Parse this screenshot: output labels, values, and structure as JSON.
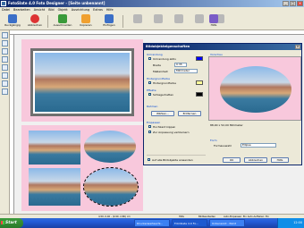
{
  "window": {
    "title": "FotoSlate 4.0 Foto Designer - [Seite unbenannt]"
  },
  "menu": [
    "Datei",
    "Bearbeiten",
    "Ansicht",
    "Bild",
    "Objekt",
    "Ausrichtung",
    "Extras",
    "Hilfe"
  ],
  "toolbar": {
    "rueckgaengig": "Ruckgängig",
    "abbrechen": "Abbrechen",
    "ausschneiden": "Ausschneiden",
    "kopieren": "Kopieren",
    "einfuegen": "Einfügen",
    "hilfe": "Hilfe"
  },
  "dialog": {
    "title": "Bildobjekteigenschaften",
    "close": "x",
    "sections": {
      "umrandung": "Umrandung",
      "hintergrundfarbe": "Hintergrundfarbe",
      "effekte": "Effekte",
      "rahmen": "Rahmen",
      "einpassen": "Einpassen",
      "vorschau": "Vorschau",
      "form": "Form"
    },
    "umrandung_aktiv": "Umrandung aktiv",
    "breite_label": "Breite",
    "breite_value": "0.35",
    "masseinheit_label": "Maßeinheit",
    "masseinheit_value": "Millimeter",
    "hintergrund_label": "Hintergrundfarbe",
    "schlagschatten": "Schlagschatten",
    "rahmen_waehlen": "Wählen...",
    "rahmen_entfernen": "Entfernen",
    "hochkant": "Hochkant kippen",
    "zur_anpassung": "Zur Anpassung verkleinern",
    "auf_alle": "Auf alle Bildobjekte anwenden",
    "preview_size": "88,90 x 52,00 Millimeter",
    "formaustritt_label": "Formauswahl",
    "form_value": "Ellipse",
    "ok": "OK",
    "abbrechen": "Abbrechen",
    "hilfe": "Hilfe"
  },
  "status": {
    "coords": "4,50, 0,40 - (0,90, 2,80) cm",
    "dpi": "Hilfe",
    "mode": "Bildbearbeiten",
    "extra": "Auto-Einpassen: Ein   Auto-Aufteilen: Ein"
  },
  "taskbar": {
    "start": "Start",
    "tasks": [
      "Druckerwarteschl...",
      "FotoSlate 4.0 Fo...",
      "Unbenannt - Paint"
    ],
    "clock": "12:00"
  }
}
